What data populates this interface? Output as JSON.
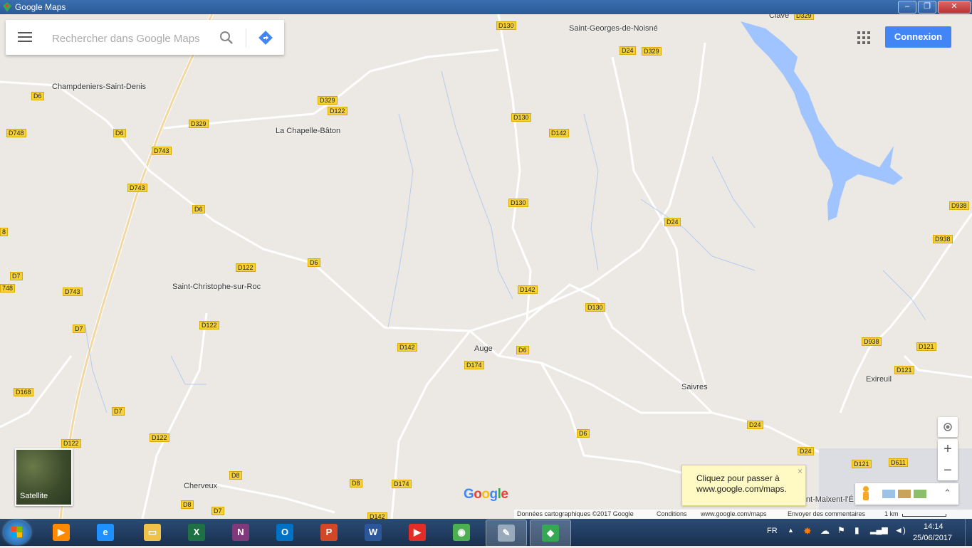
{
  "window": {
    "title": "Google Maps",
    "minimize": "–",
    "maximize": "❐",
    "close": "✕"
  },
  "search": {
    "placeholder": "Rechercher dans Google Maps"
  },
  "header": {
    "signin_label": "Connexion"
  },
  "places": {
    "champdeniers": "Champdeniers-Saint-Denis",
    "chapelle": "La Chapelle-Bâton",
    "saint_georges": "Saint-Georges-de-Noisné",
    "saint_christophe": "Saint-Christophe-sur-Roc",
    "auge": "Auge",
    "saivres": "Saivres",
    "exireuil": "Exireuil",
    "cherveux": "Cherveux",
    "saint_maixent": "Saint-Maixent-l'É",
    "clave": "Clavé"
  },
  "roads": {
    "r1": "D130",
    "r2": "D24",
    "r3": "D329",
    "r4": "D6",
    "r5": "D329",
    "r6": "D122",
    "r7": "D748",
    "r8": "D6",
    "r9": "D329",
    "r10": "D130",
    "r11": "D142",
    "r12": "D743",
    "r13": "D743",
    "r14": "D6",
    "r15": "D130",
    "r16": "D24",
    "r17": "D938",
    "r18": "D938",
    "r19": "D122",
    "r20": "D6",
    "r21": "D7",
    "r22": "748",
    "r23": "D743",
    "r24": "D142",
    "r25": "D130",
    "r26": "D122",
    "r27": "D7",
    "r28": "D142",
    "r29": "D6",
    "r30": "D174",
    "r31": "D938",
    "r32": "D121",
    "r33": "D121",
    "r34": "D168",
    "r35": "D7",
    "r36": "D122",
    "r37": "D122",
    "r38": "D6",
    "r39": "D24",
    "r40": "D24",
    "r41": "D121",
    "r42": "D611",
    "r43": "D8",
    "r44": "D8",
    "r45": "D174",
    "r46": "D8",
    "r47": "D7",
    "r48": "D142",
    "r49": "D329",
    "r50": "8"
  },
  "map_controls": {
    "satellite_label": "Satellite",
    "zoom_in": "+",
    "zoom_out": "−",
    "expand": "⌃"
  },
  "toast": {
    "text": "Cliquez pour passer à www.google.com/maps.",
    "close": "×"
  },
  "footer": {
    "data_credit": "Données cartographiques ©2017 Google",
    "conditions": "Conditions",
    "site": "www.google.com/maps",
    "feedback": "Envoyer des commentaires",
    "scale": "1 km"
  },
  "brand": {
    "logo_text": "Google"
  },
  "taskbar": {
    "apps": [
      {
        "name": "media-player",
        "glyph": "▶",
        "color": "#ff8a00"
      },
      {
        "name": "internet-explorer",
        "glyph": "e",
        "color": "#1e90ff"
      },
      {
        "name": "file-explorer",
        "glyph": "▭",
        "color": "#f0c24a"
      },
      {
        "name": "excel",
        "glyph": "X",
        "color": "#1e7145"
      },
      {
        "name": "onenote",
        "glyph": "N",
        "color": "#80397b"
      },
      {
        "name": "outlook",
        "glyph": "O",
        "color": "#0072c6"
      },
      {
        "name": "powerpoint",
        "glyph": "P",
        "color": "#d24726"
      },
      {
        "name": "word",
        "glyph": "W",
        "color": "#2b579a"
      },
      {
        "name": "youtube",
        "glyph": "▶",
        "color": "#e52d27"
      },
      {
        "name": "chrome",
        "glyph": "◉",
        "color": "#4caf50"
      },
      {
        "name": "notepad",
        "glyph": "✎",
        "color": "#9ab"
      },
      {
        "name": "google-maps",
        "glyph": "◆",
        "color": "#34a853"
      }
    ],
    "language": "FR",
    "time": "14:14",
    "date": "25/06/2017"
  },
  "colors": {
    "map_bg": "#ece9e4",
    "water": "#a0c4ff",
    "shield": "#f6d23a",
    "accent": "#4285f4"
  }
}
